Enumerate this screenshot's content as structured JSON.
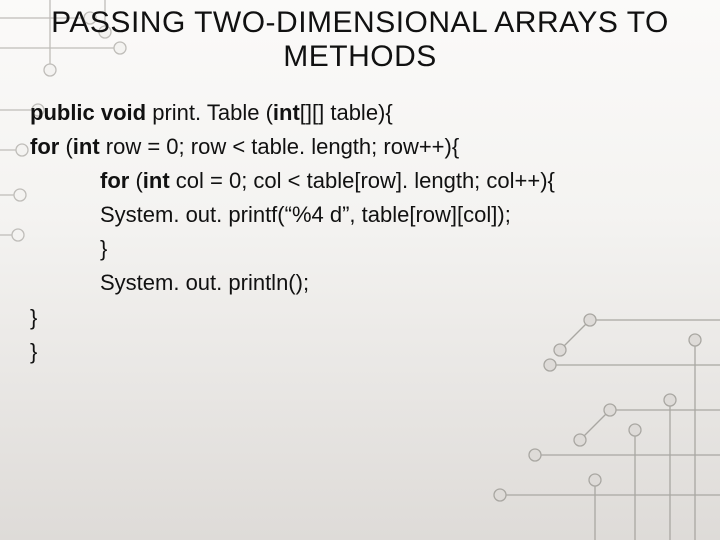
{
  "title": "PASSING TWO-DIMENSIONAL ARRAYS TO METHODS",
  "code": {
    "l1a": "public void ",
    "l1b": "print. Table (",
    "l1c": "int",
    "l1d": "[][] table){",
    "l2a": "for ",
    "l2b": "(",
    "l2c": "int ",
    "l2d": "row = 0; row < table. length; row++){",
    "l3a": "for ",
    "l3b": "(",
    "l3c": "int ",
    "l3d": "col = 0; col < table[row]. length; col++){",
    "l4": "System. out. printf(“%4 d”, table[row][col]);",
    "l5": "}",
    "l6": "System. out. println();",
    "l7": "}",
    "l8": "}"
  }
}
